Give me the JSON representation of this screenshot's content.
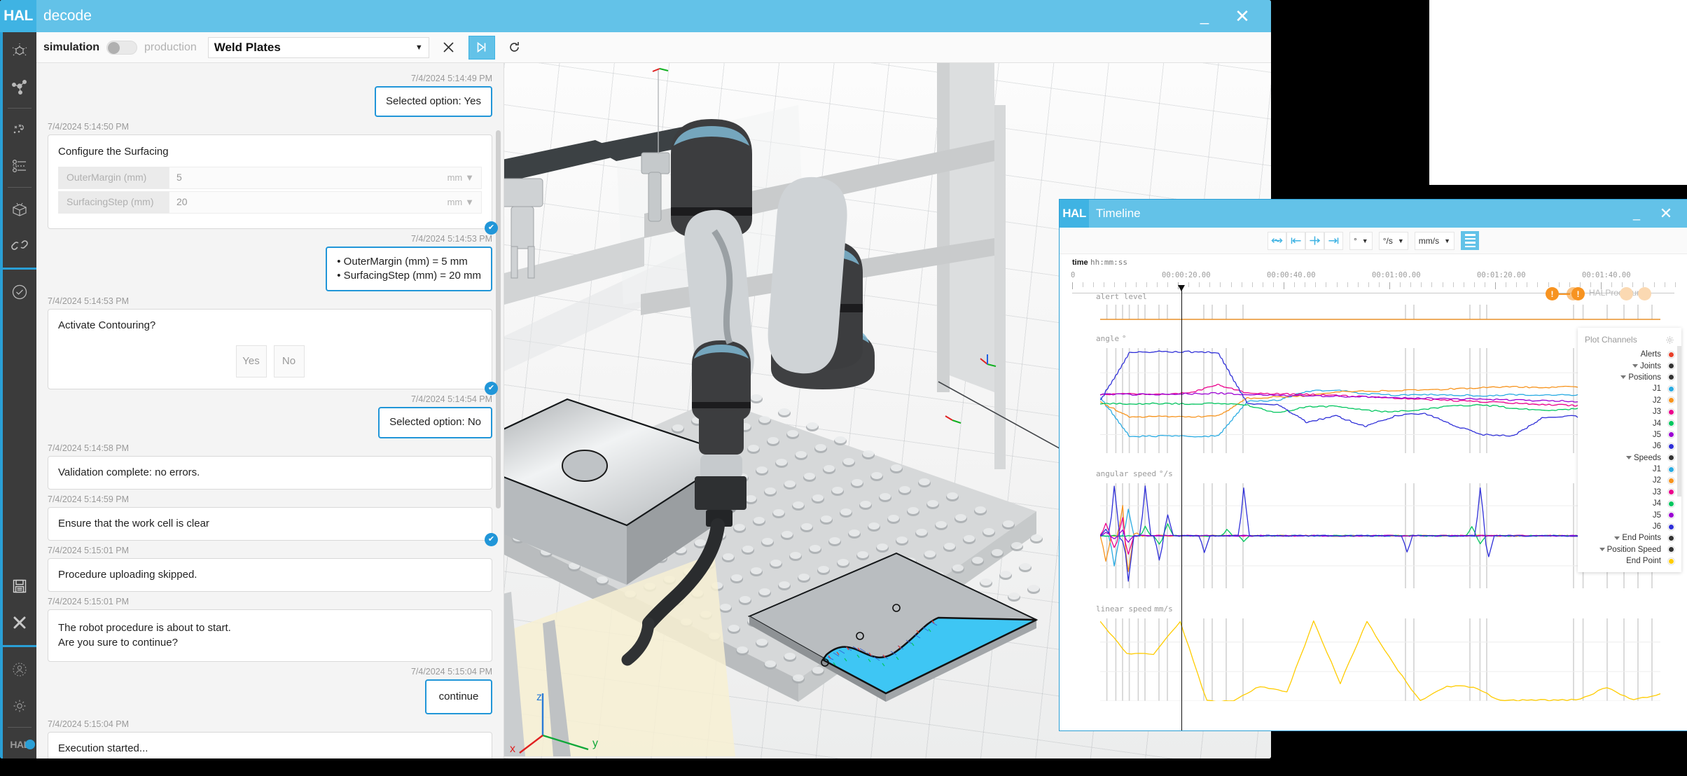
{
  "main_window": {
    "logo": "HAL",
    "title": "decode",
    "minimize": "_",
    "close": "✕"
  },
  "toolbar": {
    "simulation_label": "simulation",
    "production_label": "production",
    "toggle_state": "simulation",
    "program_select_value": "Weld Plates",
    "caret": "▼",
    "stop_icon": "✕",
    "play_icon": "▶|",
    "reset_icon": "↻"
  },
  "rail": {
    "icons": [
      {
        "name": "scene-object-icon"
      },
      {
        "name": "assembly-graph-icon"
      },
      {
        "name": "targets-icon"
      },
      {
        "name": "toolpath-icon"
      },
      {
        "name": "package-icon"
      },
      {
        "name": "link-icon"
      },
      {
        "name": "validate-check-icon"
      },
      {
        "name": "save-icon"
      },
      {
        "name": "close-icon"
      },
      {
        "name": "user-icon"
      },
      {
        "name": "settings-gear-icon"
      }
    ],
    "brand": "HAL"
  },
  "chat": {
    "messages": [
      {
        "time": "7/4/2024 5:14:49 PM",
        "side": "user",
        "type": "text",
        "text": "Selected option: Yes"
      },
      {
        "time": "7/4/2024 5:14:50 PM",
        "side": "bot",
        "type": "form",
        "title": "Configure the Surfacing",
        "checked": true,
        "fields": [
          {
            "key": "OuterMargin (mm)",
            "value": "5",
            "unit": "mm",
            "caret": "▼"
          },
          {
            "key": "SurfacingStep (mm)",
            "value": "20",
            "unit": "mm",
            "caret": "▼"
          }
        ]
      },
      {
        "time": "7/4/2024 5:14:53 PM",
        "side": "user",
        "type": "list",
        "items": [
          "• OuterMargin (mm) = 5 mm",
          "• SurfacingStep (mm) = 20 mm"
        ]
      },
      {
        "time": "7/4/2024 5:14:53 PM",
        "side": "bot",
        "type": "question",
        "checked": true,
        "text": "Activate Contouring?",
        "options": [
          "Yes",
          "No"
        ]
      },
      {
        "time": "7/4/2024 5:14:54 PM",
        "side": "user",
        "type": "text",
        "text": "Selected option: No"
      },
      {
        "time": "7/4/2024 5:14:58 PM",
        "side": "bot",
        "type": "text",
        "text": "Validation complete: no errors."
      },
      {
        "time": "7/4/2024 5:14:59 PM",
        "side": "bot",
        "type": "text",
        "checked": true,
        "text": "Ensure that the work cell is clear"
      },
      {
        "time": "7/4/2024 5:15:01 PM",
        "side": "bot",
        "type": "text",
        "text": "Procedure uploading skipped."
      },
      {
        "time": "7/4/2024 5:15:01 PM",
        "side": "bot",
        "type": "text",
        "text": "The robot procedure is about to start.\nAre you sure to continue?"
      },
      {
        "time": "7/4/2024 5:15:04 PM",
        "side": "user",
        "type": "text",
        "text": "continue"
      },
      {
        "time": "7/4/2024 5:15:04 PM",
        "side": "bot",
        "type": "text",
        "text": "Execution started..."
      }
    ]
  },
  "viewport": {
    "axis_labels": {
      "x": "x",
      "y": "y",
      "z": "z"
    }
  },
  "timeline": {
    "logo": "HAL",
    "title": "Timeline",
    "minimize": "_",
    "close": "✕",
    "toolbar": {
      "fit_icon": "↔",
      "start_icon": "|←",
      "center_icon": "—|—",
      "end_icon": "→|",
      "units": [
        {
          "name": "angle-unit-select",
          "value": "°",
          "caret": "▼"
        },
        {
          "name": "angular-speed-unit-select",
          "value": "°/s",
          "caret": "▼"
        },
        {
          "name": "linear-speed-unit-select",
          "value": "mm/s",
          "caret": "▼"
        }
      ],
      "menu_icon": "menu-icon"
    },
    "ruler": {
      "label": "time",
      "format": "hh:mm:ss",
      "zero": "0",
      "ticks": [
        "00:00:20.00",
        "00:00:40.00",
        "00:01:00.00",
        "00:01:20.00",
        "00:01:40.00"
      ],
      "procedure_name": "HALProcedure",
      "alert_badge": "!"
    },
    "legend": {
      "title": "Plot Channels",
      "gear_icon": "gear-icon",
      "rows": [
        {
          "label": "Alerts",
          "indent": 0,
          "color": "#e8402a",
          "expandable": false
        },
        {
          "label": "Joints",
          "indent": 0,
          "color": "#333333",
          "expandable": true
        },
        {
          "label": "Positions",
          "indent": 1,
          "color": "#333333",
          "expandable": true
        },
        {
          "label": "J1",
          "indent": 2,
          "color": "#29abe2",
          "expandable": false
        },
        {
          "label": "J2",
          "indent": 2,
          "color": "#f7941e",
          "expandable": false
        },
        {
          "label": "J3",
          "indent": 2,
          "color": "#ec008c",
          "expandable": false
        },
        {
          "label": "J4",
          "indent": 2,
          "color": "#00c65e",
          "expandable": false
        },
        {
          "label": "J5",
          "indent": 2,
          "color": "#9b00d3",
          "expandable": false
        },
        {
          "label": "J6",
          "indent": 2,
          "color": "#2f2fd8",
          "expandable": false
        },
        {
          "label": "Speeds",
          "indent": 1,
          "color": "#333333",
          "expandable": true
        },
        {
          "label": "J1",
          "indent": 2,
          "color": "#29abe2",
          "expandable": false
        },
        {
          "label": "J2",
          "indent": 2,
          "color": "#f7941e",
          "expandable": false
        },
        {
          "label": "J3",
          "indent": 2,
          "color": "#ec008c",
          "expandable": false
        },
        {
          "label": "J4",
          "indent": 2,
          "color": "#00c65e",
          "expandable": false
        },
        {
          "label": "J5",
          "indent": 2,
          "color": "#9b00d3",
          "expandable": false
        },
        {
          "label": "J6",
          "indent": 2,
          "color": "#2f2fd8",
          "expandable": false
        },
        {
          "label": "End Points",
          "indent": 0,
          "color": "#333333",
          "expandable": true
        },
        {
          "label": "Position Speed",
          "indent": 1,
          "color": "#333333",
          "expandable": true
        },
        {
          "label": "End Point",
          "indent": 2,
          "color": "#ffcc00",
          "expandable": false
        }
      ]
    }
  },
  "chart_data": [
    {
      "type": "line",
      "title": "alert level",
      "ylabel": "",
      "xlabel": "time hh:mm:ss",
      "series": [
        {
          "name": "Alerts",
          "color": "#e8902a",
          "values": [
            0,
            0,
            0,
            0,
            0,
            0,
            0,
            0,
            0,
            0,
            0,
            0,
            0,
            0,
            0,
            0,
            0,
            0,
            0,
            0
          ]
        }
      ],
      "ylim": [
        0,
        1
      ],
      "grid": true,
      "event_marks": [
        0.02,
        0.05,
        0.07,
        0.09,
        0.13,
        0.16,
        0.3,
        0.32,
        0.62,
        0.64,
        0.86,
        0.88,
        0.92
      ]
    },
    {
      "type": "line",
      "title": "angle",
      "unit": "°",
      "ylabel": "°",
      "ylim": [
        -160,
        180
      ],
      "yticks": [
        -100,
        0,
        100
      ],
      "grid": true,
      "series": [
        {
          "name": "J1",
          "color": "#29abe2",
          "values": [
            20,
            -105,
            -105,
            -105,
            -105,
            8,
            10,
            40,
            45,
            32,
            28,
            30,
            28,
            26,
            30,
            28,
            28,
            26,
            70,
            60
          ]
        },
        {
          "name": "J2",
          "color": "#f7941e",
          "values": [
            5,
            -42,
            -42,
            -42,
            -40,
            18,
            22,
            25,
            38,
            40,
            42,
            44,
            48,
            52,
            54,
            52,
            55,
            56,
            58,
            58
          ]
        },
        {
          "name": "J3",
          "color": "#ec008c",
          "values": [
            30,
            32,
            30,
            35,
            62,
            33,
            32,
            30,
            26,
            22,
            18,
            14,
            10,
            6,
            2,
            -2,
            -6,
            -8,
            38,
            35
          ]
        },
        {
          "name": "J4",
          "color": "#00c65e",
          "values": [
            0,
            0,
            0,
            0,
            0,
            -5,
            -30,
            -10,
            -8,
            -22,
            -26,
            -18,
            -6,
            -4,
            -14,
            -22,
            -18,
            -14,
            -5,
            -8
          ]
        },
        {
          "name": "J5",
          "color": "#9b00d3",
          "values": [
            30,
            30,
            30,
            32,
            34,
            30,
            28,
            26,
            24,
            22,
            20,
            18,
            16,
            14,
            12,
            10,
            8,
            6,
            40,
            40
          ]
        },
        {
          "name": "J6",
          "color": "#2f2fd8",
          "values": [
            10,
            165,
            168,
            168,
            165,
            0,
            -2,
            -60,
            -40,
            -74,
            -40,
            -30,
            -70,
            -100,
            -105,
            -45,
            -40,
            -55,
            72,
            70
          ]
        }
      ]
    },
    {
      "type": "line",
      "title": "angular speed",
      "unit": "°/s",
      "ylabel": "°/s",
      "ylim": [
        -175,
        175
      ],
      "yticks": [
        -100,
        0,
        100
      ],
      "grid": true,
      "series": [
        {
          "name": "J1",
          "color": "#29abe2",
          "values": [
            0,
            -100,
            0,
            90,
            0,
            0,
            0,
            0,
            0,
            0,
            0,
            0,
            0,
            0,
            0,
            0,
            0,
            0,
            0,
            0
          ]
        },
        {
          "name": "J2",
          "color": "#f7941e",
          "values": [
            -85,
            0,
            100,
            -120,
            10,
            0,
            0,
            0,
            0,
            0,
            0,
            0,
            0,
            0,
            0,
            0,
            0,
            0,
            0,
            0
          ]
        },
        {
          "name": "J3",
          "color": "#ec008c",
          "values": [
            40,
            -40,
            60,
            -60,
            0,
            0,
            0,
            0,
            0,
            0,
            0,
            0,
            0,
            0,
            0,
            0,
            0,
            0,
            0,
            0
          ]
        },
        {
          "name": "J4",
          "color": "#00c65e",
          "values": [
            0,
            0,
            0,
            0,
            0,
            30,
            -30,
            40,
            0,
            0,
            20,
            -20,
            0,
            0,
            30,
            -25,
            0,
            0,
            20,
            0
          ]
        },
        {
          "name": "J5",
          "color": "#9b00d3",
          "values": [
            10,
            -10,
            20,
            -20,
            0,
            0,
            0,
            0,
            0,
            0,
            0,
            0,
            0,
            0,
            0,
            0,
            0,
            0,
            0,
            0
          ]
        },
        {
          "name": "J6",
          "color": "#2f2fd8",
          "values": [
            20,
            165,
            -20,
            -150,
            0,
            165,
            -80,
            70,
            -55,
            0,
            0,
            160,
            -55,
            0,
            0,
            160,
            -70,
            0,
            0,
            0
          ]
        }
      ]
    },
    {
      "type": "line",
      "title": "linear speed",
      "unit": "mm/s",
      "ylabel": "mm/s",
      "ylim": [
        0,
        560
      ],
      "yticks": [
        0,
        200,
        400
      ],
      "grid": true,
      "series": [
        {
          "name": "End Point",
          "color": "#ffcc00",
          "values": [
            540,
            320,
            320,
            540,
            0,
            0,
            100,
            60,
            540,
            120,
            540,
            250,
            0,
            100,
            95,
            5,
            5,
            5,
            10,
            95,
            5,
            50
          ]
        }
      ]
    }
  ]
}
